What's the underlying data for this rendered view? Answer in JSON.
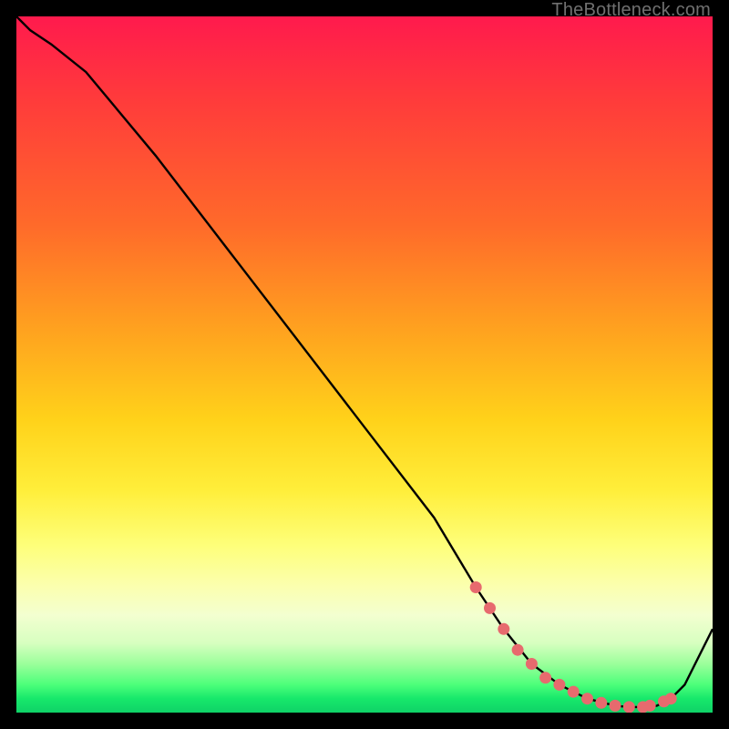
{
  "watermark": "TheBottleneck.com",
  "colors": {
    "frame": "#000000",
    "marker": "#e76a6e",
    "line": "#000000"
  },
  "chart_data": {
    "type": "line",
    "title": "",
    "xlabel": "",
    "ylabel": "",
    "xlim": [
      0,
      100
    ],
    "ylim": [
      0,
      100
    ],
    "series": [
      {
        "name": "curve",
        "x": [
          0,
          2,
          5,
          10,
          20,
          30,
          40,
          50,
          60,
          66,
          70,
          74,
          78,
          82,
          86,
          88,
          90,
          92,
          94,
          96,
          100
        ],
        "y": [
          100,
          98,
          96,
          92,
          80,
          67,
          54,
          41,
          28,
          18,
          12,
          7,
          4,
          2,
          1,
          0.8,
          0.8,
          1,
          2,
          4,
          12
        ]
      }
    ],
    "markers": {
      "name": "highlight-dots",
      "x": [
        66,
        68,
        70,
        72,
        74,
        76,
        78,
        80,
        82,
        84,
        86,
        88,
        90,
        91,
        93,
        94
      ],
      "y": [
        18,
        15,
        12,
        9,
        7,
        5,
        4,
        3,
        2,
        1.4,
        1,
        0.8,
        0.8,
        1,
        1.6,
        2
      ]
    }
  }
}
